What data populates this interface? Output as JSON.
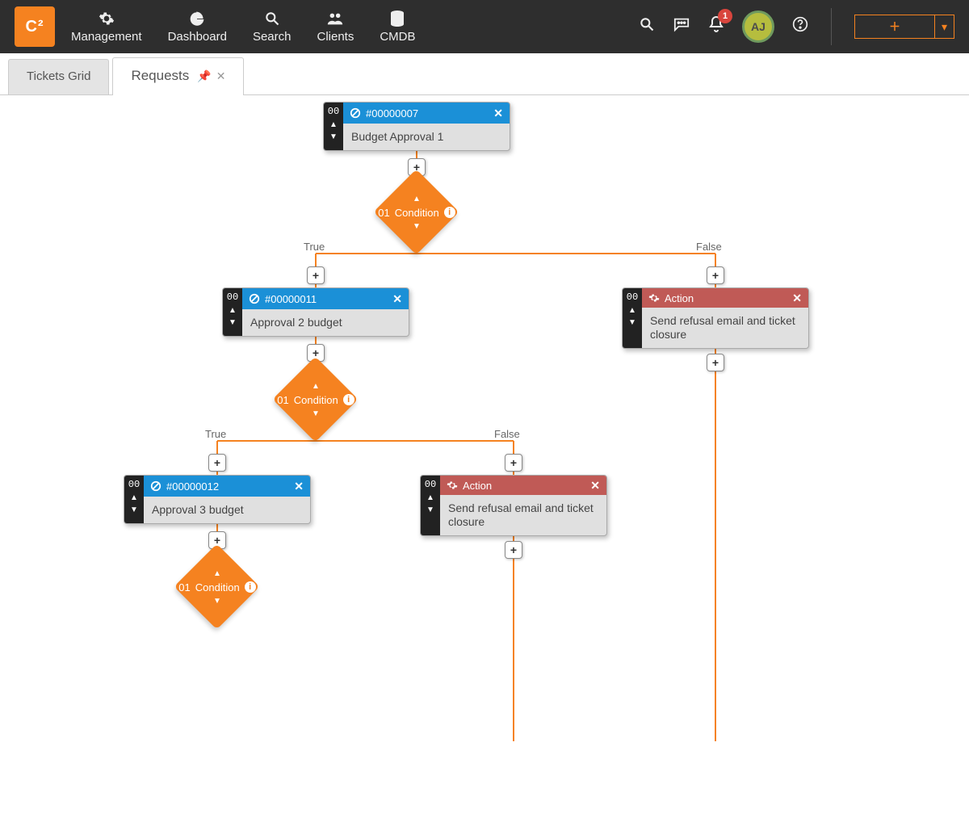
{
  "logo_text": "C²",
  "nav": {
    "items": [
      {
        "label": "Management",
        "icon": "gear"
      },
      {
        "label": "Dashboard",
        "icon": "pie"
      },
      {
        "label": "Search",
        "icon": "search"
      },
      {
        "label": "Clients",
        "icon": "users"
      },
      {
        "label": "CMDB",
        "icon": "database"
      }
    ],
    "notification_count": "1",
    "avatar_initials": "AJ"
  },
  "tabs": {
    "inactive_label": "Tickets Grid",
    "active_label": "Requests"
  },
  "branches": {
    "true_label": "True",
    "false_label": "False"
  },
  "nodes": {
    "n1": {
      "sidebar_num": "00",
      "ticket_id": "#00000007",
      "desc": "Budget Approval 1"
    },
    "n2": {
      "sidebar_num": "00",
      "ticket_id": "#00000011",
      "desc": "Approval 2 budget"
    },
    "n3": {
      "sidebar_num": "00",
      "ticket_id": "#00000012",
      "desc": "Approval 3 budget"
    },
    "a1": {
      "sidebar_num": "00",
      "title": "Action",
      "desc": "Send refusal email and ticket closure"
    },
    "a2": {
      "sidebar_num": "00",
      "title": "Action",
      "desc": "Send refusal email and ticket closure"
    }
  },
  "conditions": {
    "c1": {
      "num": "01",
      "label": "Condition"
    },
    "c2": {
      "num": "01",
      "label": "Condition"
    },
    "c3": {
      "num": "01",
      "label": "Condition"
    }
  }
}
